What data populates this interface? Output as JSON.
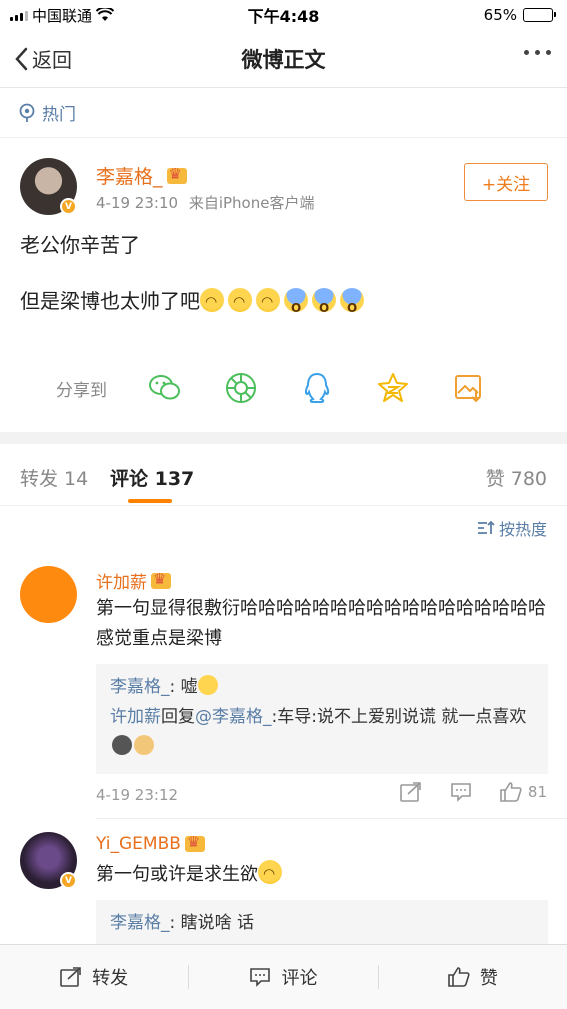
{
  "status_bar": {
    "carrier": "中国联通",
    "time": "下午4:48",
    "battery": "65%",
    "battery_level": 0.65
  },
  "nav": {
    "back_label": "返回",
    "title": "微博正文"
  },
  "hot": {
    "label": "热门"
  },
  "post": {
    "author": "李嘉格_",
    "time": "4-19 23:10",
    "source": "来自iPhone客户端",
    "follow_label": "+关注",
    "line1": "老公你辛苦了",
    "line2": "但是梁博也太帅了吧",
    "share_label": "分享到"
  },
  "tabs": {
    "repost": "转发 14",
    "comment": "评论 137",
    "like": "赞 780"
  },
  "sort_label": "按热度",
  "comments": [
    {
      "name": "许加薪",
      "text": "第一句显得很敷衍哈哈哈哈哈哈哈哈哈哈哈哈哈哈哈哈哈 感觉重点是梁博",
      "replies": [
        {
          "name": "李嘉格_",
          "text": ": 嘘"
        },
        {
          "name": "许加薪",
          "mid": "回复",
          "mention": "@李嘉格_",
          "text": ":车导:说不上爱别说谎 就一点喜欢"
        }
      ],
      "time": "4-19 23:12",
      "likes": "81"
    },
    {
      "name": "Yi_GEMBB",
      "text": "第一句或许是求生欲",
      "replies": [
        {
          "name": "李嘉格_",
          "text": ": 瞎说啥 话"
        }
      ]
    }
  ],
  "bottom_bar": {
    "repost": "转发",
    "comment": "评论",
    "like": "赞"
  }
}
